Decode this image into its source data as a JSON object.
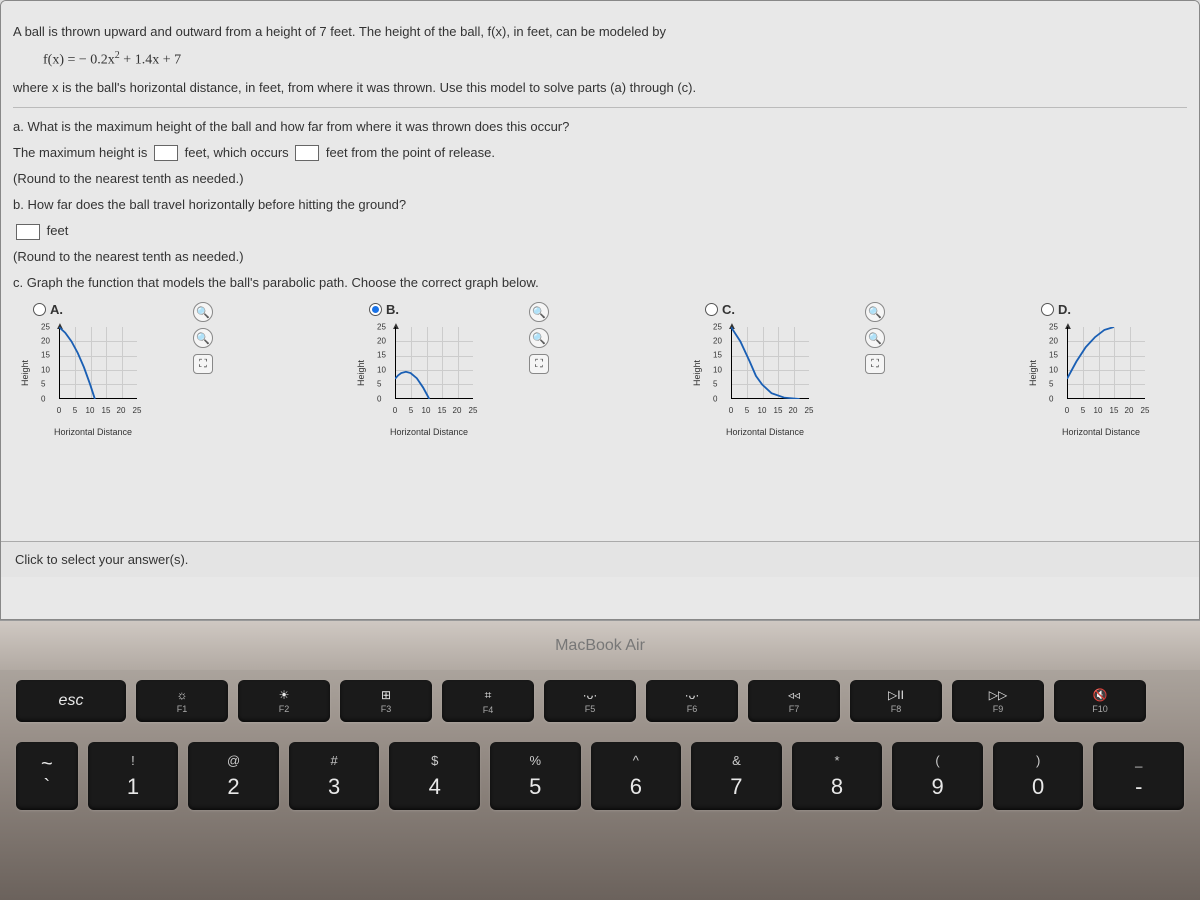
{
  "problem": {
    "intro_1": "A ball is thrown upward and outward from a height of 7 feet. The height of the ball, f(x), in feet, can be modeled by",
    "formula_lhs": "f(x) = ",
    "formula_rhs_a": "− 0.2x",
    "formula_rhs_exp": "2",
    "formula_rhs_b": " + 1.4x + 7",
    "intro_2": "where x is the ball's horizontal distance, in feet, from where it was thrown. Use this model to solve parts (a) through (c).",
    "part_a_q": "a. What is the maximum height of the ball and how far from where it was thrown does this occur?",
    "part_a_fill_1": "The maximum height is ",
    "part_a_fill_2": " feet, which occurs ",
    "part_a_fill_3": " feet from the point of release.",
    "round_note": "(Round to the nearest tenth as needed.)",
    "part_b_q": "b. How far does the ball travel horizontally before hitting the ground?",
    "part_b_unit": " feet",
    "part_c_q": "c. Graph the function that models the ball's parabolic path. Choose the correct graph below."
  },
  "options": {
    "a": "A.",
    "b": "B.",
    "c": "C.",
    "d": "D.",
    "selected": "b"
  },
  "axes": {
    "ylabel": "Height",
    "xlabel": "Horizontal Distance",
    "yticks": [
      "0",
      "5",
      "10",
      "15",
      "20",
      "25"
    ],
    "xticks": [
      "0",
      "5",
      "10",
      "15",
      "20",
      "25"
    ]
  },
  "chart_data": [
    {
      "type": "line",
      "option": "A",
      "ylabel": "Height",
      "xlabel": "Horizontal Distance",
      "xlim": [
        0,
        25
      ],
      "ylim": [
        0,
        25
      ],
      "points": [
        [
          0,
          25
        ],
        [
          2,
          23
        ],
        [
          4,
          20
        ],
        [
          6,
          16
        ],
        [
          8,
          11
        ],
        [
          10,
          5
        ],
        [
          11.5,
          0
        ]
      ]
    },
    {
      "type": "line",
      "option": "B",
      "ylabel": "Height",
      "xlabel": "Horizontal Distance",
      "xlim": [
        0,
        25
      ],
      "ylim": [
        0,
        25
      ],
      "points": [
        [
          0,
          7
        ],
        [
          1,
          8.2
        ],
        [
          2,
          9
        ],
        [
          3.5,
          9.45
        ],
        [
          5,
          9
        ],
        [
          7,
          7.2
        ],
        [
          9,
          4
        ],
        [
          11,
          0
        ]
      ]
    },
    {
      "type": "line",
      "option": "C",
      "ylabel": "Height",
      "xlabel": "Horizontal Distance",
      "xlim": [
        0,
        25
      ],
      "ylim": [
        0,
        25
      ],
      "points": [
        [
          0,
          25
        ],
        [
          3,
          20
        ],
        [
          6,
          13
        ],
        [
          8,
          8
        ],
        [
          10,
          5
        ],
        [
          13,
          2
        ],
        [
          17,
          0.5
        ],
        [
          22,
          0
        ]
      ]
    },
    {
      "type": "line",
      "option": "D",
      "ylabel": "Height",
      "xlabel": "Horizontal Distance",
      "xlim": [
        0,
        25
      ],
      "ylim": [
        0,
        25
      ],
      "points": [
        [
          0,
          7
        ],
        [
          3,
          13
        ],
        [
          6,
          18
        ],
        [
          9,
          21.5
        ],
        [
          12,
          24
        ],
        [
          15,
          25
        ]
      ]
    }
  ],
  "footer": "Click to select your answer(s).",
  "laptop": {
    "brand": "MacBook Air",
    "esc": "esc",
    "fn": [
      {
        "icon": "☼",
        "label": "F1"
      },
      {
        "icon": "☀",
        "label": "F2"
      },
      {
        "icon": "⊞",
        "label": "F3"
      },
      {
        "icon": "⌗",
        "label": "F4"
      },
      {
        "icon": "·ᴗ·",
        "label": "F5"
      },
      {
        "icon": "·ᴗ·",
        "label": "F6"
      },
      {
        "icon": "◃◃",
        "label": "F7"
      },
      {
        "icon": "▷II",
        "label": "F8"
      },
      {
        "icon": "▷▷",
        "label": "F9"
      },
      {
        "icon": "🔇",
        "label": "F10"
      }
    ],
    "tilde": {
      "top": "~",
      "bottom": "`"
    },
    "nums": [
      {
        "top": "!",
        "bottom": "1"
      },
      {
        "top": "@",
        "bottom": "2"
      },
      {
        "top": "#",
        "bottom": "3"
      },
      {
        "top": "$",
        "bottom": "4"
      },
      {
        "top": "%",
        "bottom": "5"
      },
      {
        "top": "^",
        "bottom": "6"
      },
      {
        "top": "&",
        "bottom": "7"
      },
      {
        "top": "*",
        "bottom": "8"
      },
      {
        "top": "(",
        "bottom": "9"
      },
      {
        "top": ")",
        "bottom": "0"
      },
      {
        "top": "_",
        "bottom": "-"
      }
    ]
  }
}
